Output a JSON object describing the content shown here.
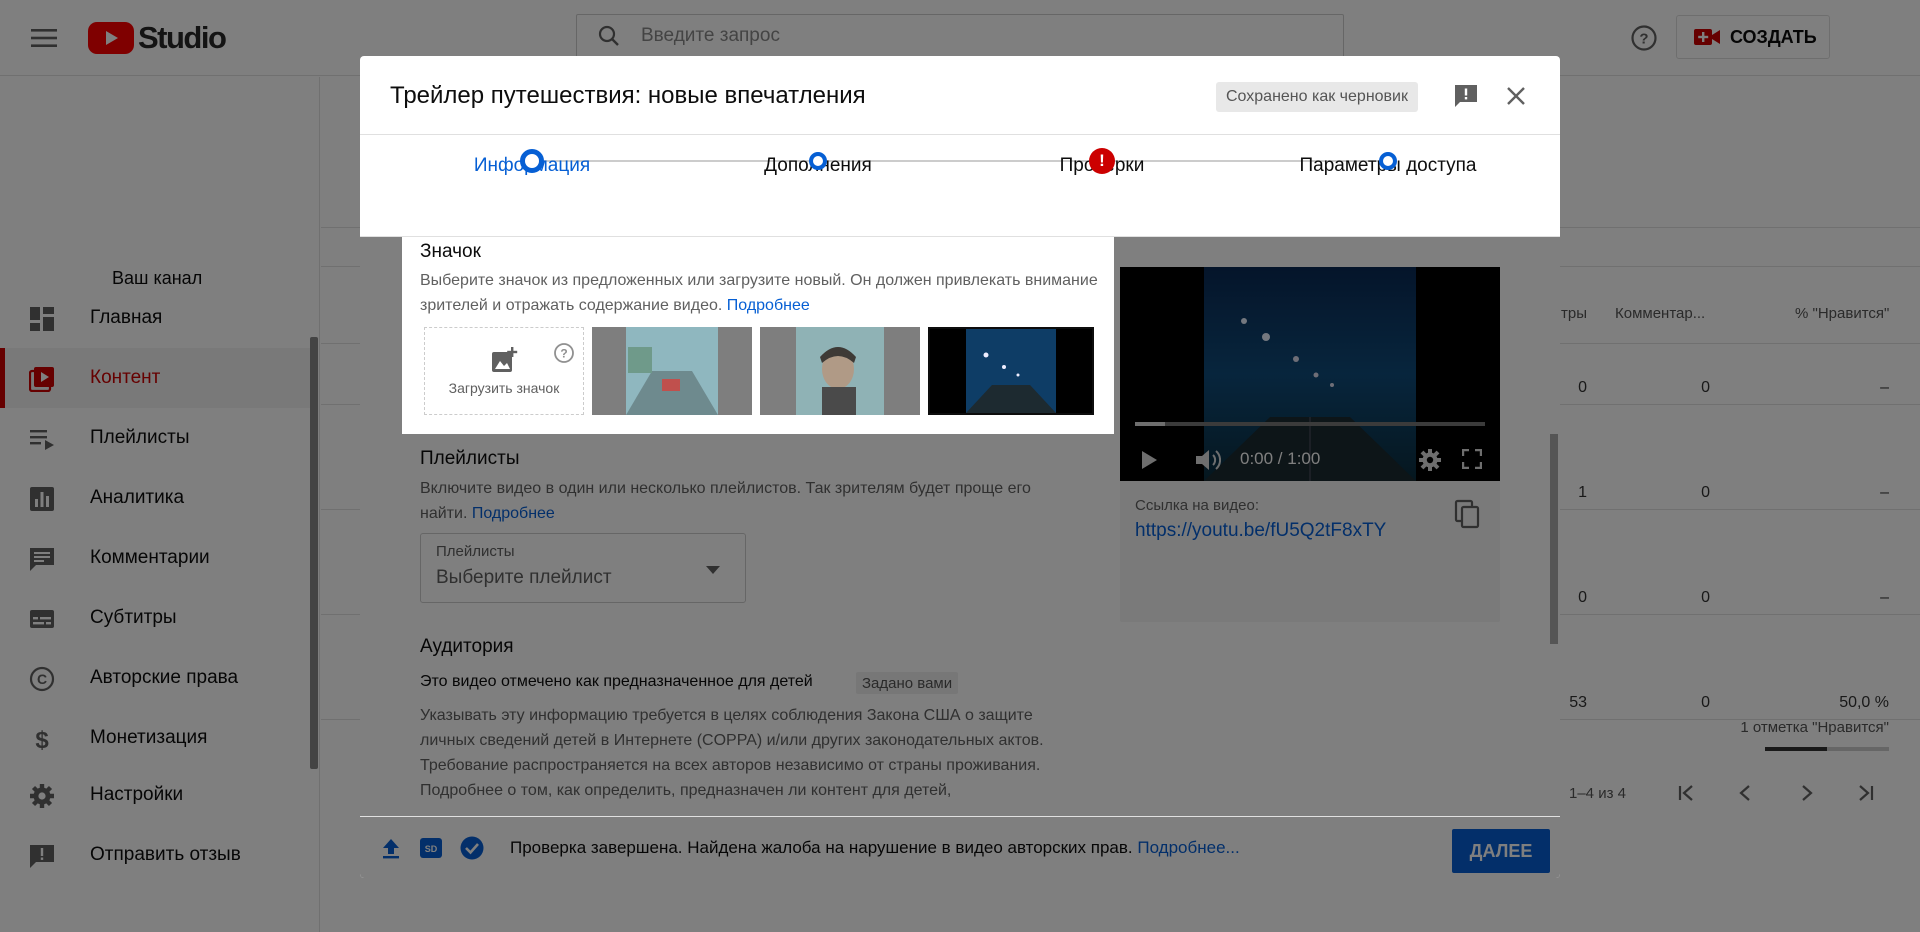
{
  "header": {
    "logo_text": "Studio",
    "search_placeholder": "Введите запрос",
    "create_label": "СОЗДАТЬ"
  },
  "sidebar": {
    "channel_label": "Ваш канал",
    "items": [
      {
        "label": "Главная",
        "icon": "dashboard-icon"
      },
      {
        "label": "Контент",
        "icon": "content-icon",
        "active": true
      },
      {
        "label": "Плейлисты",
        "icon": "playlists-icon"
      },
      {
        "label": "Аналитика",
        "icon": "analytics-icon"
      },
      {
        "label": "Комментарии",
        "icon": "comments-icon"
      },
      {
        "label": "Субтитры",
        "icon": "subtitles-icon"
      },
      {
        "label": "Авторские права",
        "icon": "copyright-icon"
      },
      {
        "label": "Монетизация",
        "icon": "dollar-icon"
      },
      {
        "label": "Настройки",
        "icon": "gear-icon"
      },
      {
        "label": "Отправить отзыв",
        "icon": "feedback-icon"
      }
    ]
  },
  "background_table": {
    "headers": [
      "тры",
      "Комментар...",
      "% \"Нравится\""
    ],
    "rows": [
      {
        "views": "0",
        "comments": "0",
        "likes": "–"
      },
      {
        "views": "1",
        "comments": "0",
        "likes": "–"
      },
      {
        "views": "0",
        "comments": "0",
        "likes": "–"
      },
      {
        "views": "53",
        "comments": "0",
        "likes": "50,0 %",
        "likes_note": "1 отметка \"Нравится\"",
        "like_ratio": 0.5
      }
    ],
    "pagination": "1–4 из 4"
  },
  "dialog": {
    "title": "Трейлер путешествия: новые впечатления",
    "draft_badge": "Сохранено как черновик",
    "steps": [
      {
        "label": "Информация",
        "state": "active"
      },
      {
        "label": "Дополнения",
        "state": "pending"
      },
      {
        "label": "Проверки",
        "state": "error"
      },
      {
        "label": "Параметры доступа",
        "state": "pending"
      }
    ],
    "thumbnail": {
      "title": "Значок",
      "description": "Выберите значок из предложенных или загрузите новый. Он должен привлекать внимание зрителей и отражать содержание видео.",
      "more_link": "Подробнее",
      "upload_label": "Загрузить значок"
    },
    "playlists": {
      "title": "Плейлисты",
      "description": "Включите видео в один или несколько плейлистов. Так зрителям будет проще его найти.",
      "more_link": "Подробнее",
      "select_label": "Плейлисты",
      "select_value": "Выберите плейлист"
    },
    "audience": {
      "title": "Аудитория",
      "kids_label": "Это видео отмечено как предназначенное для детей",
      "kids_badge": "Задано вами",
      "coppa_text": "Указывать эту информацию требуется в целях соблюдения Закона США о защите личных сведений детей в Интернете (COPPA) и/или других законодательных актов. Требование распространяется на всех авторов независимо от страны проживания. Подробнее о том, как определить, предназначен ли контент для детей,"
    },
    "video": {
      "time": "0:00 / 1:00",
      "link_label": "Ссылка на видео:",
      "link": "https://youtu.be/fU5Q2tF8xTY"
    },
    "footer": {
      "status": "Проверка завершена. Найдена жалоба на нарушение в видео авторских прав.",
      "more_link": "Подробнее...",
      "next_label": "ДАЛЕЕ"
    }
  },
  "colors": {
    "accent": "#065fd4",
    "brand_red": "#ff0000",
    "error": "#cc0000"
  }
}
